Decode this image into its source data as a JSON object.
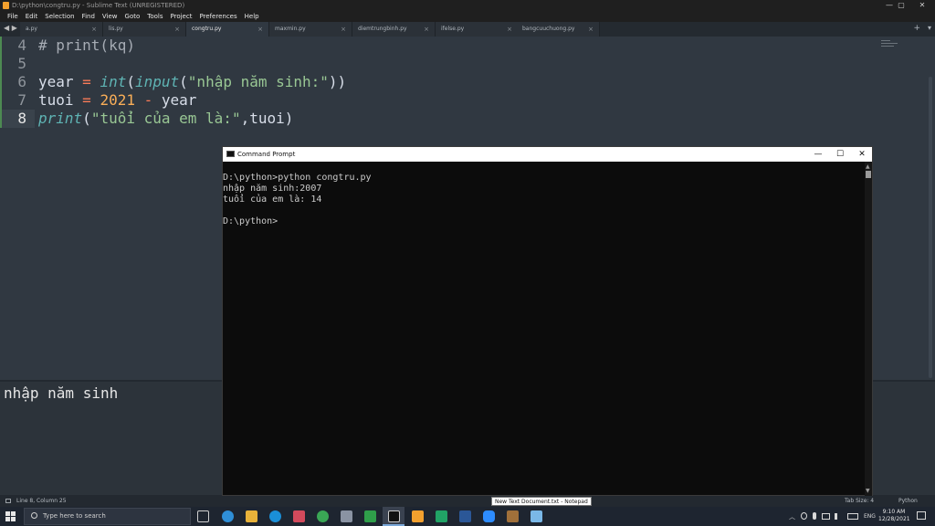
{
  "window": {
    "title": "D:\\python\\congtru.py - Sublime Text (UNREGISTERED)",
    "min_glyph": "—",
    "max_glyph": "▢",
    "close_glyph": "✕"
  },
  "menu": [
    "File",
    "Edit",
    "Selection",
    "Find",
    "View",
    "Goto",
    "Tools",
    "Project",
    "Preferences",
    "Help"
  ],
  "tabs": {
    "nav_glyph": "◀ ▶",
    "close_glyph": "×",
    "plus_glyph": "+",
    "down_glyph": "▾",
    "items": [
      {
        "label": "a.py",
        "active": false
      },
      {
        "label": "lis.py",
        "active": false
      },
      {
        "label": "congtru.py",
        "active": true
      },
      {
        "label": "maxmin.py",
        "active": false
      },
      {
        "label": "diemtrungbinh.py",
        "active": false
      },
      {
        "label": "ifelse.py",
        "active": false
      },
      {
        "label": "bangcuuchuong.py",
        "active": false
      }
    ]
  },
  "editor": {
    "line_numbers": [
      "4",
      "5",
      "6",
      "7",
      "8"
    ],
    "line4": {
      "comment": "# print(kq)"
    },
    "line6": {
      "var": "year",
      "eq": " = ",
      "fn1": "int",
      "p1": "(",
      "fn2": "input",
      "p2": "(",
      "str": "\"nhập năm sinh:\"",
      "p3": "))"
    },
    "line7": {
      "var": "tuoi",
      "eq": " = ",
      "num": "2021",
      "minus": " - ",
      "var2": "year"
    },
    "line8": {
      "fn": "print",
      "p1": "(",
      "str": "\"tuổi của em là:\"",
      "rest": ",tuoi)"
    }
  },
  "panel": {
    "text": "nhập năm sinh"
  },
  "status": {
    "position": "Line 8, Column 25",
    "tab_size": "Tab Size: 4",
    "syntax": "Python"
  },
  "cmd": {
    "title": "Command Prompt",
    "min_glyph": "—",
    "max_glyph": "☐",
    "close_glyph": "✕",
    "scroll_up": "▲",
    "scroll_down": "▼",
    "lines": [
      "D:\\python>python congtru.py",
      "nhập năm sinh:2007",
      "tuổi của em là: 14",
      "",
      "D:\\python>"
    ]
  },
  "tooltip": {
    "text": "New Text Document.txt - Notepad"
  },
  "taskbar": {
    "search_placeholder": "Type here to search",
    "tray_chevron": "︿",
    "language": "ENG",
    "time": "9:10 AM",
    "date": "12/28/2021"
  },
  "colors": {
    "editor_bg": "#303841",
    "keyword_op": "#f97b58",
    "function": "#5fb4b4",
    "string": "#99c794",
    "number": "#f9ae58",
    "cmd_bg": "#0c0c0c",
    "taskbar_bg": "#1e2530"
  }
}
